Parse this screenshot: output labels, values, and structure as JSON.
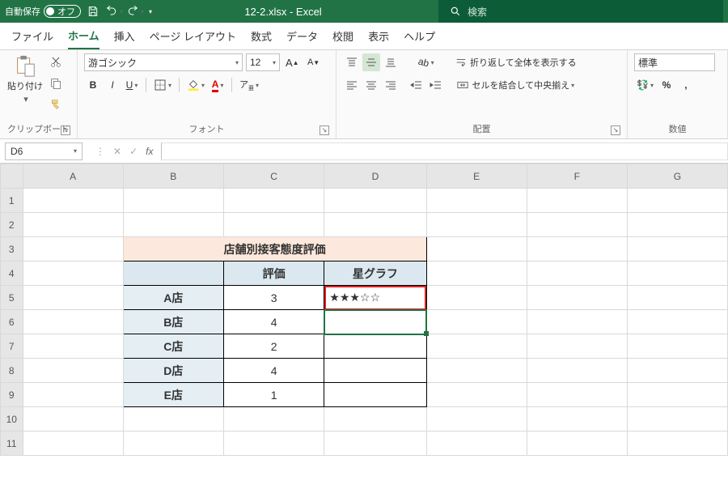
{
  "titlebar": {
    "autosave_label": "自動保存",
    "autosave_state": "オフ",
    "filename": "12-2.xlsx  -  Excel",
    "search_placeholder": "検索"
  },
  "tabs": {
    "file": "ファイル",
    "home": "ホーム",
    "insert": "挿入",
    "layout": "ページ レイアウト",
    "formulas": "数式",
    "data": "データ",
    "review": "校閲",
    "view": "表示",
    "help": "ヘルプ"
  },
  "ribbon": {
    "clipboard": {
      "paste": "貼り付け",
      "label": "クリップボード"
    },
    "font": {
      "name": "游ゴシック",
      "size": "12",
      "label": "フォント"
    },
    "align": {
      "wrap": "折り返して全体を表示する",
      "merge": "セルを結合して中央揃え",
      "label": "配置"
    },
    "number": {
      "style": "標準",
      "label": "数値"
    }
  },
  "formula_bar": {
    "cell_ref": "D6",
    "formula": ""
  },
  "columns": [
    "A",
    "B",
    "C",
    "D",
    "E",
    "F",
    "G"
  ],
  "rows": [
    "1",
    "2",
    "3",
    "4",
    "5",
    "6",
    "7",
    "8",
    "9",
    "10",
    "11"
  ],
  "sheet": {
    "title": "店舗別接客態度評価",
    "h_eval": "評価",
    "h_star": "星グラフ",
    "stores": [
      {
        "name": "A店",
        "score": "3",
        "stars": "★★★☆☆"
      },
      {
        "name": "B店",
        "score": "4",
        "stars": ""
      },
      {
        "name": "C店",
        "score": "2",
        "stars": ""
      },
      {
        "name": "D店",
        "score": "4",
        "stars": ""
      },
      {
        "name": "E店",
        "score": "1",
        "stars": ""
      }
    ]
  },
  "active_cell": "D6"
}
